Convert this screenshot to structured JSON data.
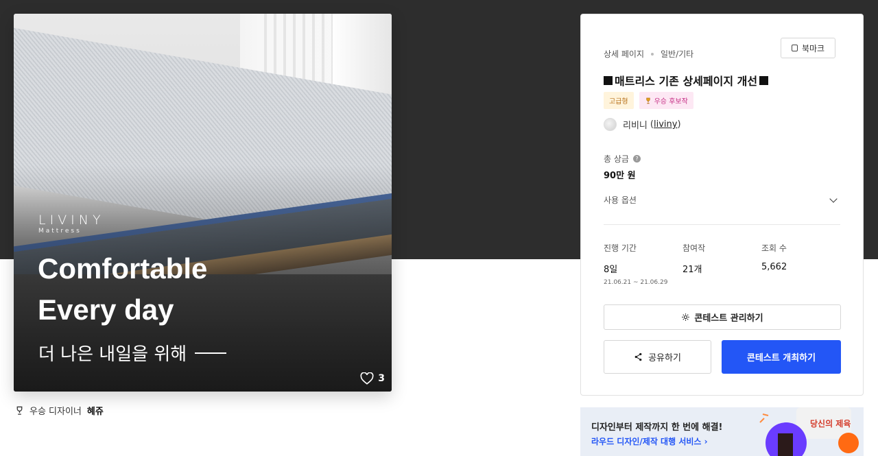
{
  "hero": {
    "brand_name": "LIVINY",
    "brand_sub": "Mattress",
    "headline_line1": "Comfortable",
    "headline_line2": "Every day",
    "tagline": "더 나은 내일을 위해",
    "like_count": "3"
  },
  "winner": {
    "label": "우승 디자이너",
    "name": "혜쥬"
  },
  "panel": {
    "breadcrumb": [
      "상세 페이지",
      "일반/기타"
    ],
    "bookmark_label": "북마크",
    "title": "매트리스 기존 상세페이지 개선",
    "badges": {
      "premium": "고급형",
      "candidate": "우승 후보작"
    },
    "owner_name": "리비니",
    "owner_id": "liviny",
    "prize_label": "총 상금",
    "prize_value": "90만 원",
    "usage_option_label": "사용 옵션",
    "stats": [
      {
        "label": "진행 기간",
        "value": "8일",
        "sub": "21.06.21 ~ 21.06.29"
      },
      {
        "label": "참여작",
        "value": "21개",
        "sub": ""
      },
      {
        "label": "조회 수",
        "value": "5,662",
        "sub": ""
      }
    ],
    "manage_button": "콘테스트 관리하기",
    "share_button": "공유하기",
    "host_button": "콘테스트 개최하기"
  },
  "ad": {
    "title": "디자인부터 제작까지 한 번에 해결!",
    "link": "라우드 디자인/제작 대행 서비스",
    "art_text": "당신의 제육"
  },
  "colors": {
    "primary": "#2356f6",
    "dark_band": "#2d2d2d"
  }
}
